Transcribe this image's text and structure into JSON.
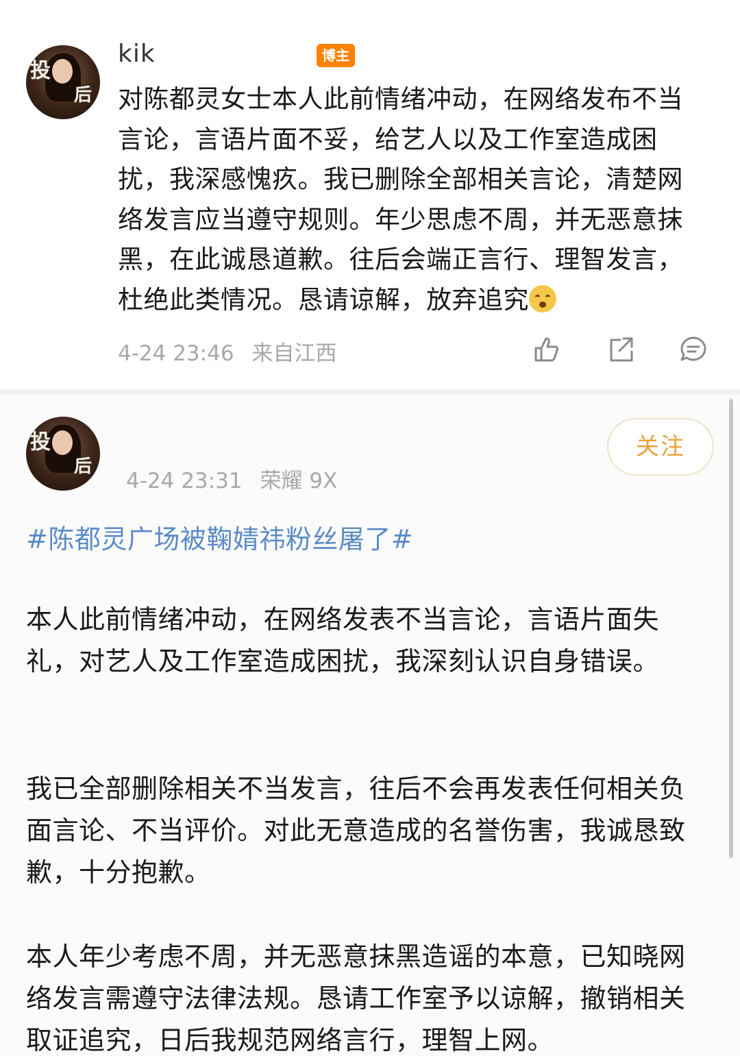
{
  "post1": {
    "username": "kik",
    "badge": "博主",
    "body": "对陈都灵女士本人此前情绪冲动，在网络发布不当言论，言语片面不妥，给艺人以及工作室造成困扰，我深感愧疚。我已删除全部相关言论，清楚网络发言应当遵守规则。年少思虑不周，并无恶意抹黑，在此诚恳道歉。往后会端正言行、理智发言，杜绝此类情况。恳请谅解，放弃追究",
    "time": "4-24 23:46",
    "source": "来自江西",
    "icons": [
      "like-icon",
      "share-icon",
      "comment-icon"
    ]
  },
  "post2": {
    "time": "4-24 23:31",
    "source": "荣耀 9X",
    "follow_label": "关注",
    "topic": "#陈都灵广场被鞠婧祎粉丝屠了#",
    "paragraphs": [
      "本人此前情绪冲动，在网络发表不当言论，言语片面失礼，对艺人及工作室造成困扰，我深刻认识自身错误。",
      "我已全部删除相关不当发言，往后不会再发表任何相关负面言论、不当评价。对此无意造成的名誉伤害，我诚恳致歉，十分抱歉。",
      "本人年少考虑不周，并无恶意抹黑造谣的本意，已知晓网络发言需遵守法律法规。恳请工作室予以谅解，撤销相关取证追究，日后我规范网络言行，理智上网。"
    ]
  },
  "colors": {
    "badge": "#ff8200",
    "topic": "#5b8bc7",
    "follow_text": "#e9a23b",
    "meta": "#a8a8a8"
  }
}
